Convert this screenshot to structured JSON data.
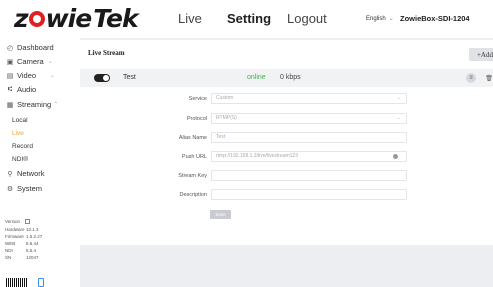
{
  "header": {
    "logo_pre": "z",
    "logo_mid": "wie",
    "logo_end": "Tek",
    "nav": {
      "live": "Live",
      "setting": "Setting",
      "logout": "Logout"
    },
    "language": "English",
    "device_name": "ZowieBox-SDI-1204"
  },
  "sidebar": {
    "items": [
      {
        "label": "Dashboard",
        "icon": "dashboard-icon"
      },
      {
        "label": "Camera",
        "icon": "camera-icon"
      },
      {
        "label": "Video",
        "icon": "video-icon"
      },
      {
        "label": "Audio",
        "icon": "audio-icon"
      },
      {
        "label": "Streaming",
        "icon": "streaming-icon"
      },
      {
        "label": "Network",
        "icon": "network-icon"
      },
      {
        "label": "System",
        "icon": "gear-icon"
      }
    ],
    "streaming_sub": [
      "Local",
      "Live",
      "Record",
      "NDI®"
    ],
    "info": [
      {
        "key": "Version",
        "value": ""
      },
      {
        "key": "Hardware",
        "value": "10.1.3"
      },
      {
        "key": "Firmware",
        "value": "1.5.2.27"
      },
      {
        "key": "WEB",
        "value": "5.6.44"
      },
      {
        "key": "NDI",
        "value": "5.5.4"
      },
      {
        "key": "SN",
        "value": "12047"
      }
    ]
  },
  "main": {
    "title": "Live Stream",
    "add_label": "+Add",
    "stream": {
      "name": "Test",
      "status": "online",
      "bitrate": "0 kbps"
    },
    "form": {
      "service_label": "Service",
      "service_value": "Custom",
      "protocol_label": "Protocol",
      "protocol_value": "RTMP(S)",
      "alias_label": "Alias Name",
      "alias_value": "Test",
      "url_label": "Push URL",
      "url_value": "rtmp://192.168.1.3/live/livestream123",
      "key_label": "Stream Key",
      "key_value": "",
      "desc_label": "Description",
      "desc_value": "",
      "save_label": "Save"
    }
  },
  "colors": {
    "accent": "#e8a93a",
    "online": "#4caf50",
    "logo_red": "#e02020"
  }
}
